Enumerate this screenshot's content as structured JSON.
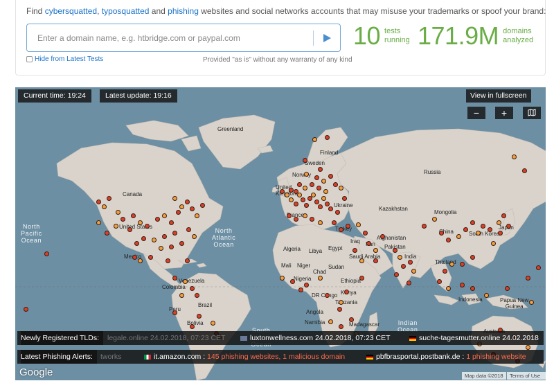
{
  "intro": {
    "prefix": "Find ",
    "link1": "cybersquatted",
    "sep1": ", ",
    "link2": "typosquatted",
    "sep2": " and ",
    "link3": "phishing",
    "suffix": " websites and social networks accounts that may misuse your trademarks or spoof your brand:"
  },
  "search": {
    "placeholder": "Enter a domain name, e.g. htbridge.com or paypal.com",
    "value": ""
  },
  "hide_label": "Hide from Latest Tests",
  "provided_note": "Provided \"as is\" without any warranty of any kind",
  "stats": {
    "tests_count": "10",
    "tests_label_1": "tests",
    "tests_label_2": "running",
    "domains_count": "171.9M",
    "domains_label_1": "domains",
    "domains_label_2": "analyzed"
  },
  "map": {
    "current_time": "Current time: 19:24",
    "latest_update": "Latest update: 19:16",
    "fullscreen": "View in fullscreen",
    "zoom_out": "−",
    "zoom_in": "+",
    "ocean_labels": {
      "north_pacific": "North\nPacific\nOcean",
      "north_atlantic": "North\nAtlantic\nOcean",
      "indian": "Indian\nOcean",
      "south_atlantic": "South\nAtlantic\nOcean"
    },
    "place_labels": {
      "greenland": "Greenland",
      "finland": "Finland",
      "sweden": "Sweden",
      "norway": "Norway",
      "russia": "Russia",
      "canada": "Canada",
      "united_kingdom": "United\nKingdom",
      "ukraine": "Ukraine",
      "kazakhstan": "Kazakhstan",
      "mongolia": "Mongolia",
      "united_states": "United States",
      "france": "France",
      "turkey": "Turkey",
      "china": "China",
      "south_korea": "South Korea",
      "japan": "Japan",
      "afghanistan": "Afghanistan",
      "iraq": "Iraq",
      "iran": "Iran",
      "pakistan": "Pakistan",
      "algeria": "Algeria",
      "libya": "Libya",
      "egypt": "Egypt",
      "saudi_arabia": "Saudi Arabia",
      "india": "India",
      "mexico": "Mexico",
      "mali": "Mali",
      "niger": "Niger",
      "chad": "Chad",
      "sudan": "Sudan",
      "thailand": "Thailand",
      "venezuela": "Venezuela",
      "colombia": "Colombia",
      "nigeria": "Nigeria",
      "ethiopia": "Ethiopia",
      "kenya": "Kenya",
      "dr_congo": "DR Congo",
      "tanzania": "Tanzania",
      "indonesia": "Indonesia",
      "papua_new_guinea": "Papua New\nGuinea",
      "peru": "Peru",
      "brazil": "Brazil",
      "angola": "Angola",
      "namibia": "Namibia",
      "madagascar": "Madagascar",
      "bolivia": "Bolivia",
      "australia": "Australia"
    },
    "tld_ticker": {
      "label": "Newly Registered TLDs:",
      "items": [
        {
          "text": "legale.online 24.02.2018, 07:23 CET",
          "flag": ""
        },
        {
          "text": "luxtonwellness.com 24.02.2018, 07:23 CET",
          "flag": "flag-generic"
        },
        {
          "text": "suche-tagesmutter.online 24.02.2018",
          "flag": "flag-germany"
        }
      ]
    },
    "phishing_ticker": {
      "label": "Latest Phishing Alerts:",
      "lead_fragment": "tworks",
      "items": [
        {
          "domain": "it.amazon.com",
          "separator": " : ",
          "detail": "145 phishing websites, 1 malicious domain",
          "flag": "flag-italy"
        },
        {
          "domain": "pbfbrasportal.postbank.de",
          "separator": " : ",
          "detail": "1 phishing website",
          "flag": "flag-germany"
        }
      ]
    },
    "google": "Google",
    "map_data": "Map data ©2018",
    "terms": "Terms of Use",
    "colors": {
      "water": "#6d8fa3",
      "land": "#d9d3cb",
      "dot_red": "#d8402a",
      "dot_orange": "#f0a040"
    }
  }
}
